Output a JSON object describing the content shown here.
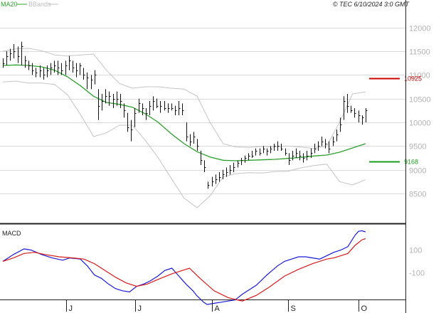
{
  "legend": {
    "ma_label": "MA20",
    "bb_label": "BBands",
    "ma_color": "#2ca02c",
    "bb_color": "#bdbdbd"
  },
  "copyright": "© TEC 6/10/2024 3:0 GMT",
  "chart_data": [
    {
      "type": "ohlc",
      "xlabel": "",
      "ylabel": "",
      "ylim": [
        7900,
        12400
      ],
      "yticks": [
        8500,
        9000,
        9500,
        10000,
        10500,
        11000,
        11500,
        12000
      ],
      "ytick_labels": [
        "8500",
        "9000",
        "9500",
        "10000",
        "10500",
        "11000",
        "11500",
        "12000"
      ],
      "grid": true,
      "months": [
        "J",
        "J",
        "A",
        "S",
        "O"
      ],
      "levels": [
        {
          "label": "10925",
          "value": 10925,
          "color": "#cc0000"
        },
        {
          "label": "9168",
          "value": 9168,
          "color": "#1a9c1a"
        }
      ],
      "bars": [
        [
          11350,
          11150,
          11250
        ],
        [
          11500,
          11200,
          11400
        ],
        [
          11550,
          11300,
          11450
        ],
        [
          11650,
          11350,
          11500
        ],
        [
          11600,
          11250,
          11400
        ],
        [
          11700,
          11200,
          11600
        ],
        [
          11400,
          11150,
          11300
        ],
        [
          11300,
          11100,
          11200
        ],
        [
          11250,
          11000,
          11100
        ],
        [
          11150,
          10950,
          11050
        ],
        [
          11200,
          10950,
          11100
        ],
        [
          11150,
          10900,
          11000
        ],
        [
          11200,
          10950,
          11100
        ],
        [
          11250,
          11000,
          11150
        ],
        [
          11300,
          11050,
          11200
        ],
        [
          11300,
          11000,
          11150
        ],
        [
          11250,
          11000,
          11100
        ],
        [
          11300,
          11000,
          11200
        ],
        [
          11400,
          11100,
          11300
        ],
        [
          11300,
          11050,
          11150
        ],
        [
          11250,
          10950,
          11100
        ],
        [
          11250,
          11000,
          11200
        ],
        [
          11150,
          10900,
          11000
        ],
        [
          11050,
          10700,
          10950
        ],
        [
          11000,
          10700,
          10900
        ],
        [
          11100,
          10800,
          11000
        ],
        [
          10700,
          10050,
          10350
        ],
        [
          10600,
          10250,
          10450
        ],
        [
          10700,
          10400,
          10550
        ],
        [
          10650,
          10350,
          10550
        ],
        [
          10600,
          10300,
          10500
        ],
        [
          10650,
          10350,
          10500
        ],
        [
          10600,
          10300,
          10450
        ],
        [
          10400,
          10100,
          10250
        ],
        [
          10200,
          9800,
          9900
        ],
        [
          10050,
          9600,
          9850
        ],
        [
          10300,
          9900,
          10200
        ],
        [
          10500,
          10200,
          10400
        ],
        [
          10400,
          10150,
          10300
        ],
        [
          10300,
          10050,
          10200
        ],
        [
          10450,
          10150,
          10350
        ],
        [
          10550,
          10250,
          10450
        ],
        [
          10500,
          10300,
          10350
        ],
        [
          10450,
          10200,
          10350
        ],
        [
          10450,
          10250,
          10300
        ],
        [
          10400,
          10200,
          10300
        ],
        [
          10400,
          10250,
          10300
        ],
        [
          10350,
          10150,
          10250
        ],
        [
          10450,
          10150,
          10300
        ],
        [
          10400,
          10150,
          10250
        ],
        [
          10000,
          9600,
          9700
        ],
        [
          9750,
          9500,
          9600
        ],
        [
          9800,
          9550,
          9700
        ],
        [
          9650,
          9400,
          9500
        ],
        [
          9400,
          9100,
          9200
        ],
        [
          9200,
          8950,
          9050
        ],
        [
          8750,
          8600,
          8680
        ],
        [
          8850,
          8650,
          8750
        ],
        [
          8900,
          8700,
          8800
        ],
        [
          8950,
          8750,
          8850
        ],
        [
          9000,
          8800,
          8900
        ],
        [
          9050,
          8850,
          8950
        ],
        [
          9100,
          8900,
          9000
        ],
        [
          9150,
          8950,
          9050
        ],
        [
          9200,
          9050,
          9150
        ],
        [
          9250,
          9100,
          9200
        ],
        [
          9300,
          9150,
          9250
        ],
        [
          9350,
          9200,
          9300
        ],
        [
          9400,
          9250,
          9300
        ],
        [
          9450,
          9300,
          9400
        ],
        [
          9450,
          9300,
          9350
        ],
        [
          9500,
          9350,
          9450
        ],
        [
          9450,
          9300,
          9400
        ],
        [
          9500,
          9350,
          9450
        ],
        [
          9550,
          9400,
          9500
        ],
        [
          9600,
          9400,
          9500
        ],
        [
          9550,
          9400,
          9450
        ],
        [
          9450,
          9300,
          9350
        ],
        [
          9350,
          9100,
          9200
        ],
        [
          9400,
          9200,
          9300
        ],
        [
          9450,
          9250,
          9350
        ],
        [
          9400,
          9200,
          9300
        ],
        [
          9350,
          9150,
          9250
        ],
        [
          9400,
          9200,
          9300
        ],
        [
          9450,
          9250,
          9350
        ],
        [
          9550,
          9350,
          9450
        ],
        [
          9600,
          9400,
          9500
        ],
        [
          9700,
          9500,
          9600
        ],
        [
          9650,
          9450,
          9550
        ],
        [
          9600,
          9350,
          9450
        ],
        [
          9700,
          9500,
          9600
        ],
        [
          9850,
          9600,
          9750
        ],
        [
          10100,
          9800,
          9950
        ],
        [
          10550,
          10050,
          10450
        ],
        [
          10600,
          10200,
          10350
        ],
        [
          10350,
          10200,
          10250
        ],
        [
          10300,
          10100,
          10200
        ],
        [
          10250,
          10000,
          10150
        ],
        [
          10150,
          9950,
          10100
        ],
        [
          10300,
          10000,
          10250
        ]
      ],
      "ma20": [
        [
          0,
          11200
        ],
        [
          10,
          11210
        ],
        [
          20,
          11200
        ],
        [
          30,
          11170
        ],
        [
          40,
          11100
        ],
        [
          50,
          10960
        ],
        [
          60,
          10770
        ],
        [
          70,
          10550
        ],
        [
          80,
          10420
        ],
        [
          90,
          10380
        ],
        [
          100,
          10320
        ],
        [
          110,
          10180
        ],
        [
          120,
          10000
        ],
        [
          130,
          9760
        ],
        [
          140,
          9550
        ],
        [
          150,
          9380
        ],
        [
          160,
          9270
        ],
        [
          170,
          9200
        ],
        [
          180,
          9190
        ],
        [
          190,
          9200
        ],
        [
          200,
          9210
        ],
        [
          210,
          9220
        ],
        [
          220,
          9240
        ],
        [
          230,
          9260
        ],
        [
          240,
          9290
        ],
        [
          250,
          9310
        ],
        [
          260,
          9370
        ],
        [
          270,
          9460
        ],
        [
          280,
          9550
        ]
      ],
      "bb_upper": [
        [
          0,
          11500
        ],
        [
          10,
          11550
        ],
        [
          20,
          11560
        ],
        [
          30,
          11510
        ],
        [
          40,
          11420
        ],
        [
          50,
          11400
        ],
        [
          60,
          11420
        ],
        [
          70,
          11440
        ],
        [
          80,
          11100
        ],
        [
          90,
          10820
        ],
        [
          100,
          10720
        ],
        [
          110,
          10750
        ],
        [
          120,
          10750
        ],
        [
          130,
          10720
        ],
        [
          140,
          10700
        ],
        [
          150,
          10550
        ],
        [
          160,
          10000
        ],
        [
          170,
          9550
        ],
        [
          180,
          9480
        ],
        [
          190,
          9470
        ],
        [
          200,
          9490
        ],
        [
          210,
          9480
        ],
        [
          220,
          9500
        ],
        [
          230,
          9480
        ],
        [
          240,
          9450
        ],
        [
          250,
          9500
        ],
        [
          260,
          10000
        ],
        [
          270,
          10600
        ],
        [
          280,
          10640
        ]
      ],
      "bb_lower": [
        [
          0,
          10850
        ],
        [
          10,
          10870
        ],
        [
          20,
          10830
        ],
        [
          30,
          10830
        ],
        [
          40,
          10800
        ],
        [
          50,
          10580
        ],
        [
          60,
          10160
        ],
        [
          70,
          9700
        ],
        [
          80,
          9780
        ],
        [
          90,
          9940
        ],
        [
          100,
          9940
        ],
        [
          110,
          9620
        ],
        [
          120,
          9250
        ],
        [
          130,
          8820
        ],
        [
          140,
          8400
        ],
        [
          150,
          8200
        ],
        [
          160,
          8450
        ],
        [
          170,
          8850
        ],
        [
          180,
          8920
        ],
        [
          190,
          8940
        ],
        [
          200,
          8930
        ],
        [
          210,
          8960
        ],
        [
          220,
          8970
        ],
        [
          230,
          9040
        ],
        [
          240,
          9090
        ],
        [
          250,
          9120
        ],
        [
          260,
          8750
        ],
        [
          270,
          8680
        ],
        [
          280,
          8790
        ]
      ],
      "bb_x_max": 280
    },
    {
      "type": "line",
      "title": "MACD",
      "ylim": [
        -330,
        310
      ],
      "yticks": [
        100,
        -100
      ],
      "ytick_labels": [
        "100",
        "-100"
      ],
      "series": [
        {
          "name": "",
          "color": "#1a1ad8",
          "values": [
            [
              0,
              0
            ],
            [
              15,
              60
            ],
            [
              30,
              110
            ],
            [
              40,
              100
            ],
            [
              55,
              60
            ],
            [
              70,
              30
            ],
            [
              85,
              10
            ],
            [
              95,
              30
            ],
            [
              110,
              20
            ],
            [
              120,
              -40
            ],
            [
              130,
              -120
            ],
            [
              140,
              -150
            ],
            [
              150,
              -200
            ],
            [
              160,
              -240
            ],
            [
              170,
              -260
            ],
            [
              180,
              -270
            ],
            [
              190,
              -220
            ],
            [
              200,
              -200
            ],
            [
              210,
              -170
            ],
            [
              220,
              -130
            ],
            [
              230,
              -80
            ],
            [
              240,
              -60
            ],
            [
              250,
              -130
            ],
            [
              260,
              -200
            ],
            [
              270,
              -260
            ],
            [
              275,
              -300
            ],
            [
              285,
              -360
            ],
            [
              290,
              -380
            ],
            [
              300,
              -370
            ],
            [
              310,
              -360
            ],
            [
              330,
              -340
            ],
            [
              340,
              -290
            ],
            [
              360,
              -210
            ],
            [
              375,
              -120
            ],
            [
              390,
              -40
            ],
            [
              400,
              0
            ],
            [
              410,
              20
            ],
            [
              420,
              40
            ],
            [
              430,
              40
            ],
            [
              440,
              30
            ],
            [
              450,
              20
            ],
            [
              460,
              50
            ],
            [
              470,
              80
            ],
            [
              480,
              100
            ],
            [
              490,
              130
            ],
            [
              500,
              230
            ],
            [
              505,
              265
            ],
            [
              510,
              270
            ],
            [
              515,
              260
            ]
          ]
        },
        {
          "name": "",
          "color": "#d81a1a",
          "values": [
            [
              0,
              0
            ],
            [
              15,
              30
            ],
            [
              30,
              70
            ],
            [
              45,
              80
            ],
            [
              60,
              60
            ],
            [
              80,
              40
            ],
            [
              100,
              30
            ],
            [
              115,
              20
            ],
            [
              130,
              -20
            ],
            [
              145,
              -80
            ],
            [
              160,
              -140
            ],
            [
              175,
              -190
            ],
            [
              190,
              -220
            ],
            [
              205,
              -200
            ],
            [
              220,
              -160
            ],
            [
              240,
              -110
            ],
            [
              255,
              -80
            ],
            [
              265,
              -60
            ],
            [
              280,
              -150
            ],
            [
              300,
              -260
            ],
            [
              320,
              -320
            ],
            [
              340,
              -350
            ],
            [
              360,
              -300
            ],
            [
              380,
              -220
            ],
            [
              400,
              -130
            ],
            [
              420,
              -70
            ],
            [
              440,
              -20
            ],
            [
              460,
              20
            ],
            [
              470,
              30
            ],
            [
              480,
              50
            ],
            [
              490,
              70
            ],
            [
              500,
              140
            ],
            [
              510,
              190
            ],
            [
              515,
              200
            ]
          ]
        }
      ]
    }
  ]
}
